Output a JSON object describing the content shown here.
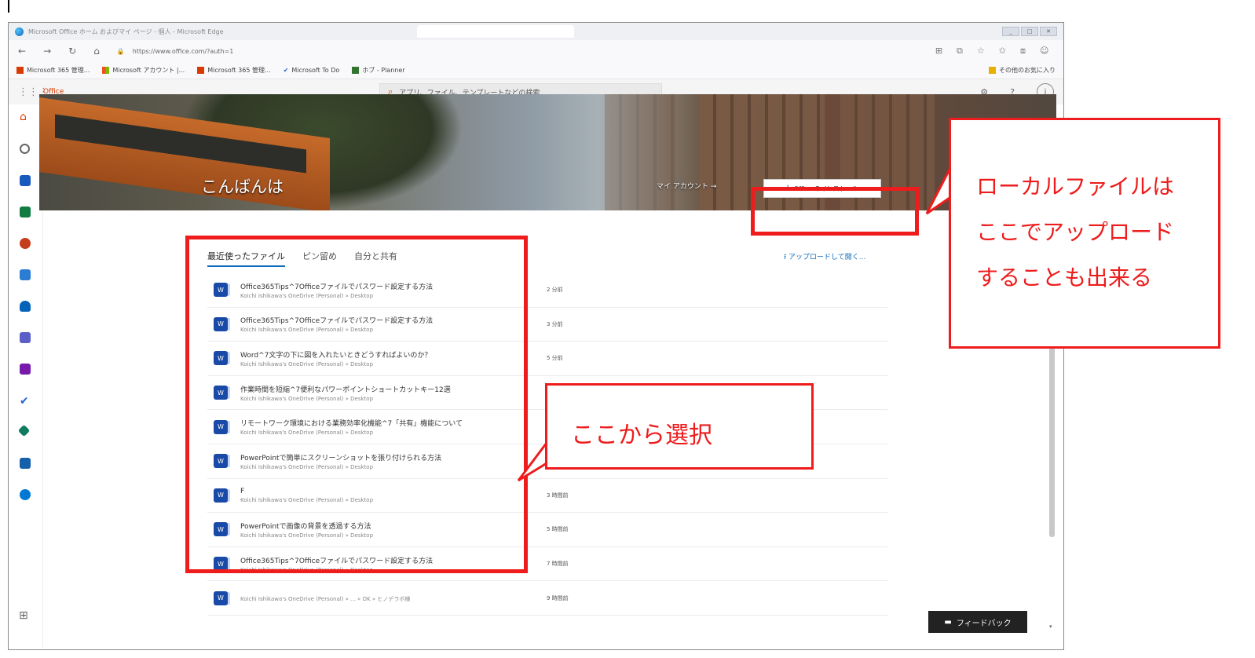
{
  "browser": {
    "title": "Microsoft Office ホーム およびマイ ページ - 個人 - Microsoft Edge",
    "url": "https://www.office.com/?auth=1",
    "favorites": [
      "Microsoft 365 管理...",
      "Microsoft アカウント |...",
      "Microsoft 365 管理...",
      "Microsoft To Do",
      "ホブ - Planner"
    ],
    "other_favorites": "その他のお気に入り"
  },
  "office": {
    "brand": "Office",
    "search_placeholder": "アプリ、ファイル、テンプレートなどの検索",
    "greeting": "こんばんは",
    "account_link": "マイ アカウント →",
    "install_label": "Office のインストール",
    "tabs": [
      "最近使ったファイル",
      "ピン留め",
      "自分と共有"
    ],
    "upload_link": "アップロードして開く...",
    "files": [
      {
        "name": "Office365Tips^7Officeファイルでパスワード設定する方法",
        "path": "Koichi Ishikawa's OneDrive (Personal) » Desktop",
        "time": "2 分前"
      },
      {
        "name": "Office365Tips^7Officeファイルでパスワード設定する方法",
        "path": "Koichi Ishikawa's OneDrive (Personal) » Desktop",
        "time": "3 分前"
      },
      {
        "name": "Word^7文字の下に図を入れたいときどうすればよいのか？",
        "path": "Koichi Ishikawa's OneDrive (Personal) » Desktop",
        "time": "5 分前"
      },
      {
        "name": "作業時間を短縮^7便利なパワーポイントショートカットキー12選",
        "path": "Koichi Ishikawa's OneDrive (Personal) » Desktop",
        "time": ""
      },
      {
        "name": "リモートワーク環境における業務効率化機能^7「共有」機能について",
        "path": "Koichi Ishikawa's OneDrive (Personal) » Desktop",
        "time": ""
      },
      {
        "name": "PowerPointで簡単にスクリーンショットを張り付けられる方法",
        "path": "Koichi Ishikawa's OneDrive (Personal) » Desktop",
        "time": ""
      },
      {
        "name": "F",
        "path": "Koichi Ishikawa's OneDrive (Personal) » Desktop",
        "time": "3 時間前"
      },
      {
        "name": "PowerPointで画像の背景を透過する方法",
        "path": "Koichi Ishikawa's OneDrive (Personal) » Desktop",
        "time": "5 時間前"
      },
      {
        "name": "Office365Tips^7Officeファイルでパスワード設定する方法",
        "path": "Koichi Ishikawa's OneDrive (Personal) » Desktop",
        "time": "7 時間前"
      },
      {
        "name": "",
        "path": "Koichi Ishikawa's OneDrive (Personal) » ... » OK » ヒノデラボ様",
        "time": "9 時間前"
      }
    ],
    "feedback": "フィードバック"
  },
  "annotations": {
    "callout_local": [
      "ローカルファイルは",
      "ここでアップロード",
      "することも出来る"
    ],
    "callout_select": "ここから選択",
    "color": "#ee1c1c"
  },
  "icons": [
    "waffle-icon",
    "search-icon",
    "settings-icon",
    "help-icon",
    "account-icon",
    "home-icon",
    "download-icon",
    "feedback-icon"
  ]
}
